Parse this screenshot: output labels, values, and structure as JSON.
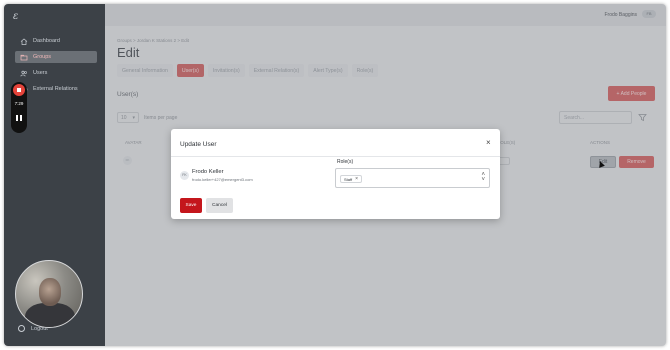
{
  "app": {
    "logo_text": "ε"
  },
  "sidebar": {
    "items": [
      {
        "label": "Dashboard",
        "icon": "home-icon"
      },
      {
        "label": "Groups",
        "icon": "folder-icon"
      },
      {
        "label": "Users",
        "icon": "users-icon"
      },
      {
        "label": "External Relations",
        "icon": "link-icon"
      }
    ],
    "logout_label": "Logout"
  },
  "recorder": {
    "time": "7:29"
  },
  "header": {
    "user_name": "Frodo Baggins",
    "user_initials": "FB"
  },
  "page": {
    "breadcrumb": "Groups  >  Jordan K Stations 2  >  Edit",
    "title": "Edit",
    "tabs": [
      {
        "label": "General Information",
        "active": false
      },
      {
        "label": "User(s)",
        "active": true
      },
      {
        "label": "Invitation(s)",
        "active": false
      },
      {
        "label": "External Relation(s)",
        "active": false
      },
      {
        "label": "Alert Type(s)",
        "active": false
      },
      {
        "label": "Role(s)",
        "active": false
      }
    ],
    "section_title": "User(s)",
    "add_button": "+  Add People",
    "per_page_value": "10",
    "per_page_label": "Items per page",
    "search_placeholder": "Search...",
    "table": {
      "headers": {
        "avatar": "AVATAR",
        "roles": "ROLE(S)",
        "actions": "ACTIONS"
      },
      "row": {
        "initials": "FK",
        "edit_label": "Edit",
        "remove_label": "Remove"
      }
    }
  },
  "modal": {
    "title": "Update User",
    "user_name": "Frodo Keller",
    "user_email": "frodo.keller+427@emergent3.com",
    "user_initials": "FK",
    "roles_label": "Role(s)",
    "selected_roles": [
      "Staff"
    ],
    "save_label": "Save",
    "cancel_label": "Cancel"
  },
  "colors": {
    "accent": "#c4161c",
    "sidebar": "#3c4147"
  }
}
